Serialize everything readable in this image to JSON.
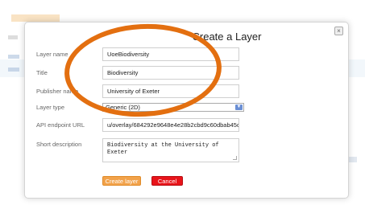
{
  "dialog": {
    "title": "Create a Layer",
    "close_icon": "close-icon"
  },
  "form": {
    "layer_name": {
      "label": "Layer name",
      "value": "UoeBiodiversity"
    },
    "title": {
      "label": "Title",
      "value": "Biodiversity"
    },
    "publisher_name": {
      "label": "Publisher name",
      "value": "University of Exeter"
    },
    "layer_type": {
      "label": "Layer type",
      "value": "Generic (2D)"
    },
    "api_endpoint": {
      "label": "API endpoint URL",
      "value": "u/overlay/684292e9648e4e28b2cbd9c60dbab45d/"
    },
    "short_description": {
      "label": "Short description",
      "value": "Biodiversity at the University of Exeter"
    }
  },
  "buttons": {
    "create_label": "Create layer",
    "cancel_label": "Cancel"
  },
  "colors": {
    "annotation": "#e36f10",
    "create_button": "#f2a24a",
    "cancel_button": "#e8141a"
  }
}
